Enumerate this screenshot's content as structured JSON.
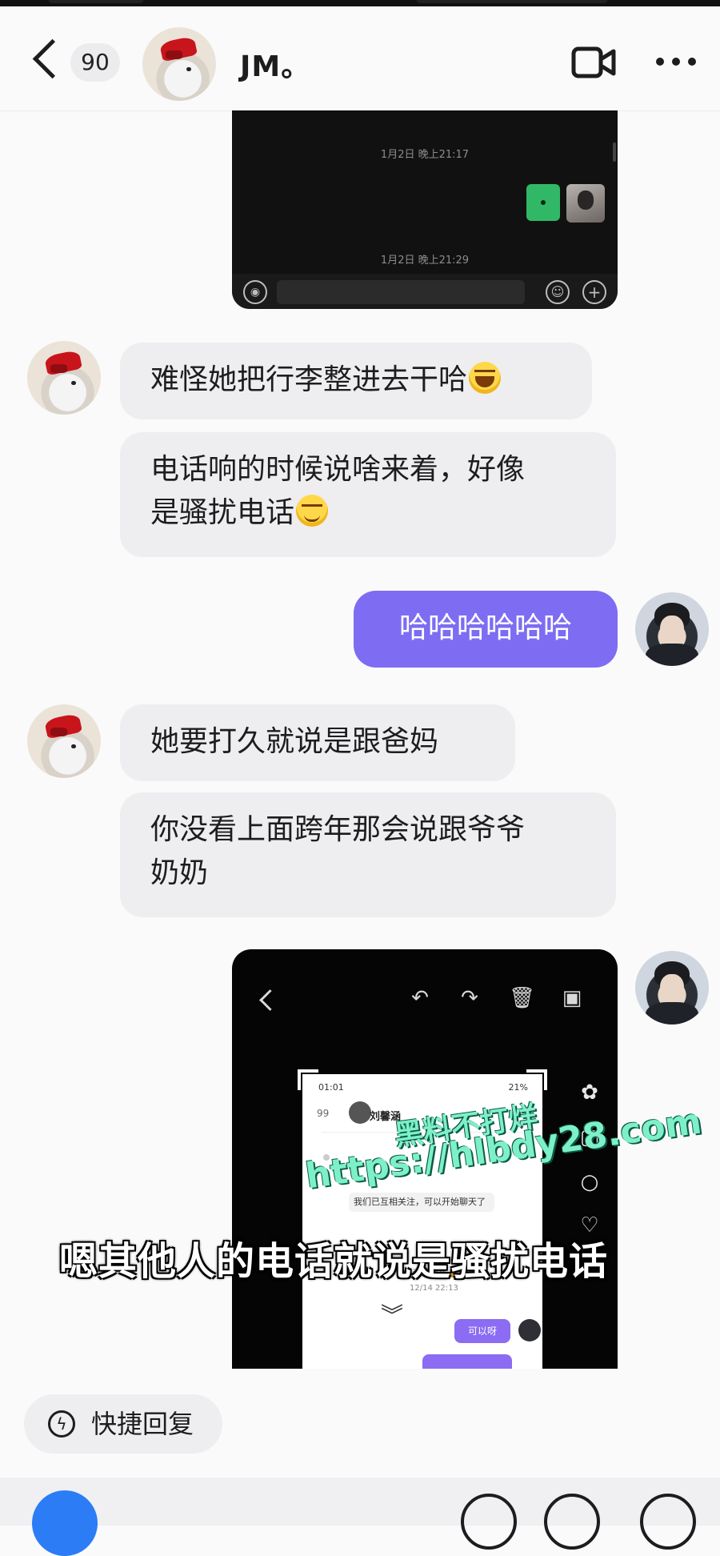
{
  "header": {
    "back_label": "‹",
    "unread_count": "90",
    "contact_name": "JM。",
    "video_icon": "video-camera-icon",
    "more_icon": "more-dots-icon"
  },
  "shared_screenshot_1": {
    "timestamp_1": "1月2日 晚上21:17",
    "timestamp_2": "1月2日 晚上21:29"
  },
  "messages": [
    {
      "side": "them",
      "text": "难怪她把行李整进去干哈",
      "emoji": "laughing-emoji"
    },
    {
      "side": "them",
      "line1": "电话响的时候说啥来着，好像",
      "line2": "是骚扰电话",
      "emoji": "smirk-emoji"
    },
    {
      "side": "me",
      "text": "哈哈哈哈哈哈"
    },
    {
      "side": "them",
      "text": "她要打久就说是跟爸妈"
    },
    {
      "side": "them",
      "line1": "你没看上面跨年那会说跟爷爷",
      "line2": "奶奶"
    }
  ],
  "shared_screenshot_2": {
    "phone": {
      "status_time": "01:01",
      "status_right": "21%",
      "back_count": "99",
      "contact": "刘馨涵",
      "system_msg": "我们已互相关注，可以开始聊天了",
      "frag": "你x涵（紧张～",
      "stamp": "12/14 22:13",
      "reply": "可以呀"
    },
    "subtitle": "嗯其他人的电话就说是骚扰电话",
    "watermark_1": "黑料不打烊",
    "watermark_2": "https://hlbdy28.com"
  },
  "quick_reply": {
    "label": "快捷回复"
  }
}
